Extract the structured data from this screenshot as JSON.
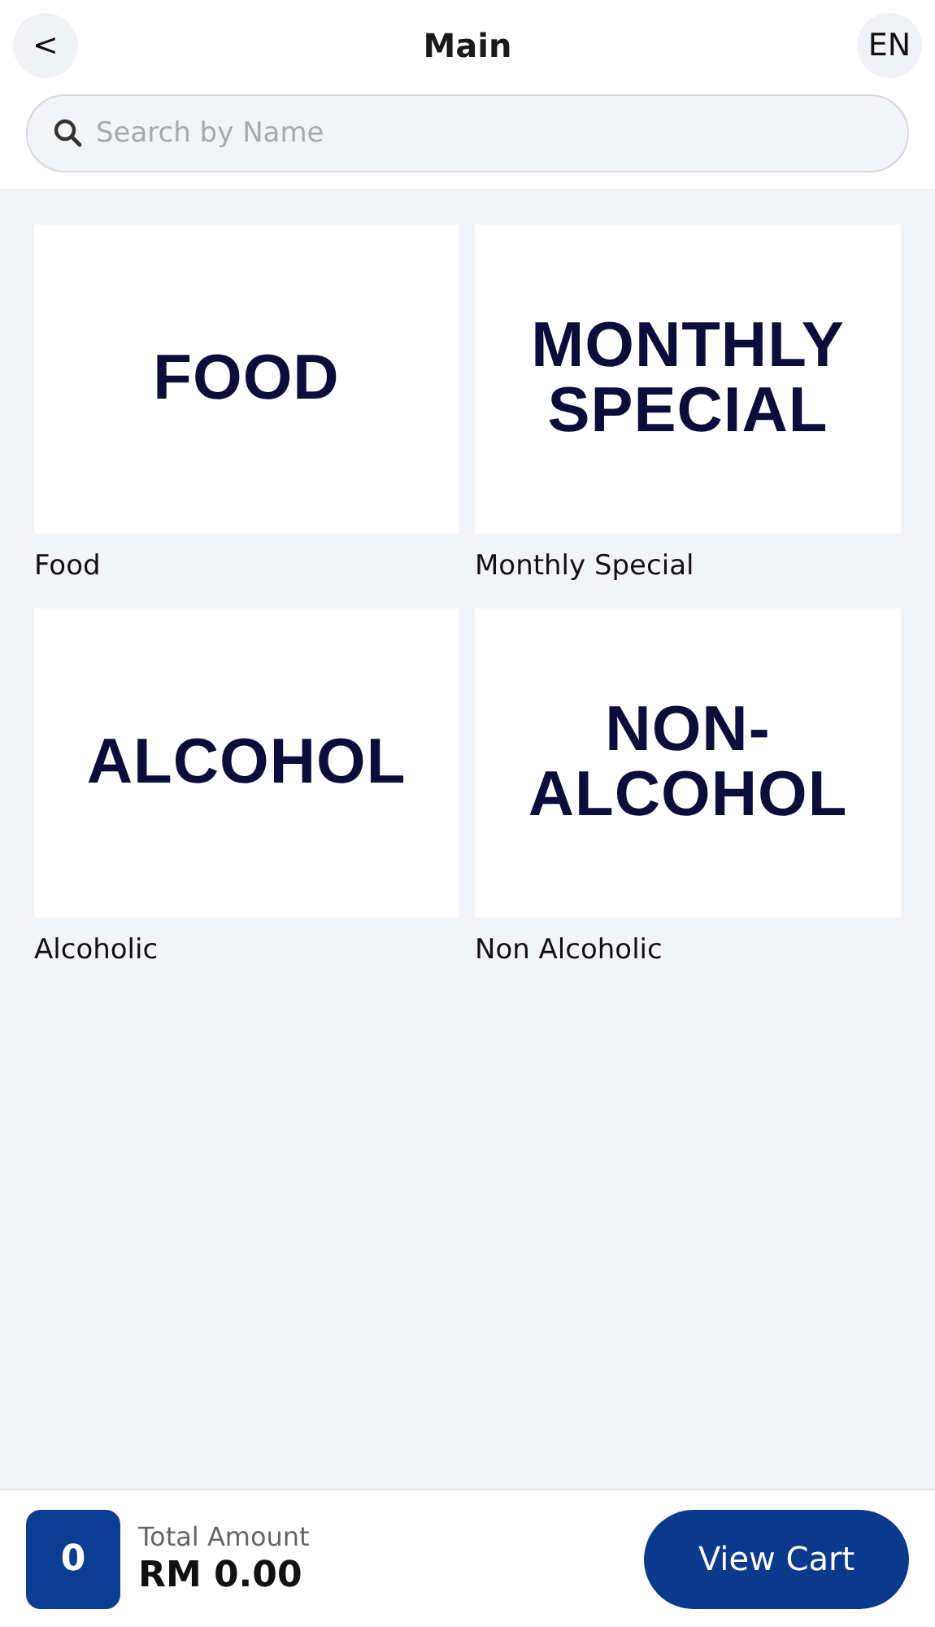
{
  "header": {
    "back": "<",
    "title": "Main",
    "language": "EN"
  },
  "search": {
    "placeholder": "Search by Name"
  },
  "categories": [
    {
      "image_lines": [
        "FOOD"
      ],
      "label": "Food"
    },
    {
      "image_lines": [
        "MONTHLY",
        "SPECIAL"
      ],
      "label": "Monthly Special"
    },
    {
      "image_lines": [
        "ALCOHOL"
      ],
      "label": "Alcoholic"
    },
    {
      "image_lines": [
        "NON-",
        "ALCOHOL"
      ],
      "label": "Non Alcoholic"
    }
  ],
  "footer": {
    "count": "0",
    "total_label": "Total Amount",
    "total": "RM 0.00",
    "button": "View Cart"
  }
}
